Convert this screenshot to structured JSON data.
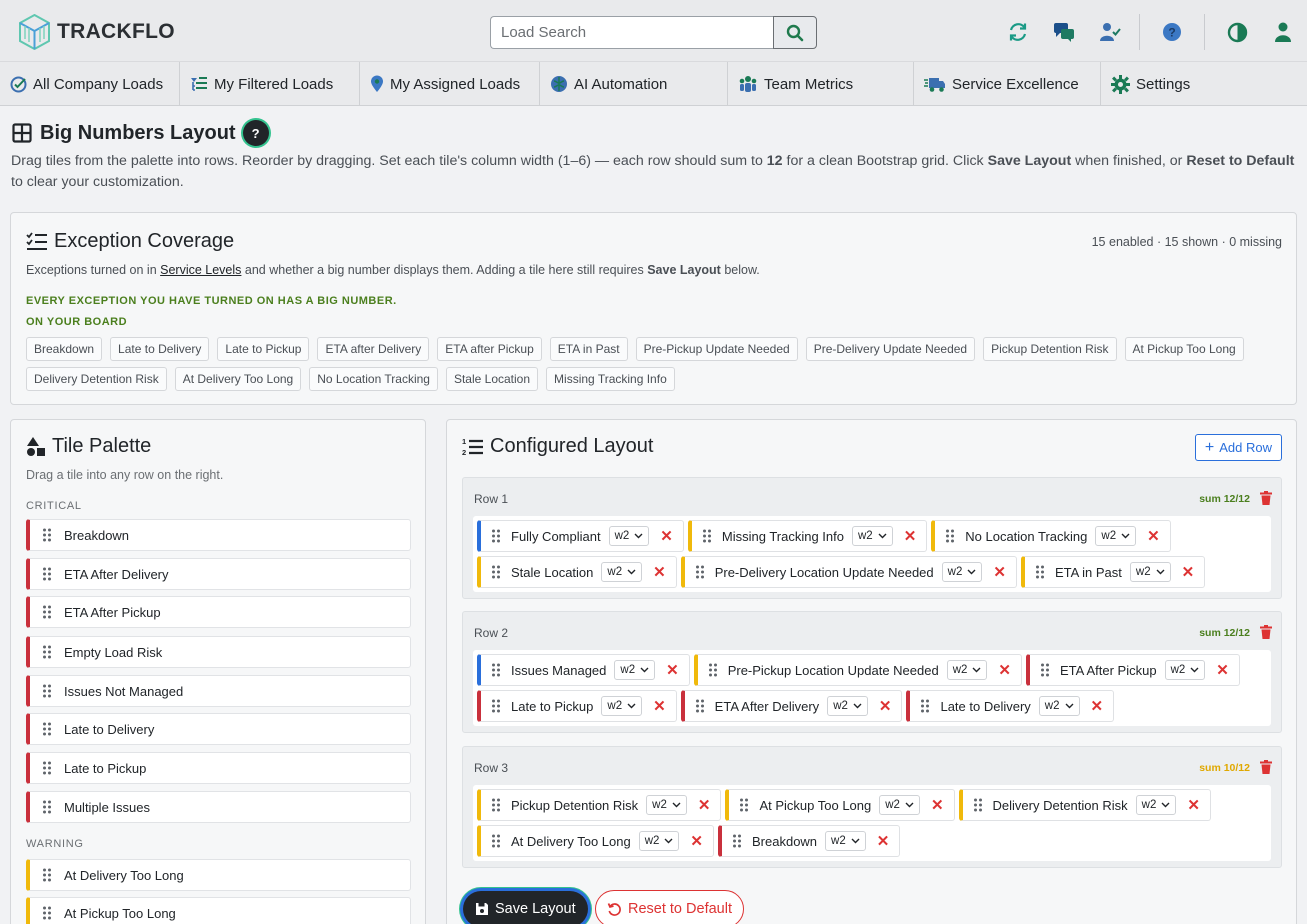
{
  "app": {
    "name": "TRACKFLO"
  },
  "search": {
    "placeholder": "Load Search"
  },
  "top_icons": [
    "refresh-icon",
    "chat-icon",
    "user-check-icon",
    "help-icon",
    "contrast-icon",
    "user-icon"
  ],
  "nav": [
    {
      "label": "All Company Loads",
      "icon": "truck-check-icon"
    },
    {
      "label": "My Filtered Loads",
      "icon": "filter-list-icon"
    },
    {
      "label": "My Assigned Loads",
      "icon": "map-pin-icon"
    },
    {
      "label": "AI Automation",
      "icon": "brain-icon"
    },
    {
      "label": "Team Metrics",
      "icon": "team-icon"
    },
    {
      "label": "Service Excellence",
      "icon": "truck-fast-icon"
    },
    {
      "label": "Settings",
      "icon": "gear-icon"
    }
  ],
  "page": {
    "title": "Big Numbers Layout",
    "help": "?",
    "intro_1": "Drag tiles from the palette into rows. Reorder by dragging. Set each tile's column width (1–6) — each row should sum to ",
    "intro_12": "12",
    "intro_2": " for a clean Bootstrap grid. Click ",
    "intro_save": "Save Layout",
    "intro_3": " when finished, or ",
    "intro_reset": "Reset to Default",
    "intro_4": " to clear your customization."
  },
  "coverage": {
    "title": "Exception Coverage",
    "stats": "15 enabled · 15 shown · 0 missing",
    "desc_1": "Exceptions turned on in ",
    "desc_link": "Service Levels",
    "desc_2": " and whether a big number displays them. Adding a tile here still requires ",
    "desc_bold": "Save Layout",
    "desc_3": " below.",
    "ok_message": "EVERY EXCEPTION YOU HAVE TURNED ON HAS A BIG NUMBER.",
    "on_board_label": "ON YOUR BOARD",
    "chips": [
      "Breakdown",
      "Late to Delivery",
      "Late to Pickup",
      "ETA after Delivery",
      "ETA after Pickup",
      "ETA in Past",
      "Pre-Pickup Update Needed",
      "Pre-Delivery Update Needed",
      "Pickup Detention Risk",
      "At Pickup Too Long",
      "Delivery Detention Risk",
      "At Delivery Too Long",
      "No Location Tracking",
      "Stale Location",
      "Missing Tracking Info"
    ]
  },
  "palette": {
    "title": "Tile Palette",
    "desc": "Drag a tile into any row on the right.",
    "critical_label": "CRITICAL",
    "critical": [
      "Breakdown",
      "ETA After Delivery",
      "ETA After Pickup",
      "Empty Load Risk",
      "Issues Not Managed",
      "Late to Delivery",
      "Late to Pickup",
      "Multiple Issues"
    ],
    "warning_label": "WARNING",
    "warning": [
      "At Delivery Too Long",
      "At Pickup Too Long"
    ]
  },
  "config": {
    "title": "Configured Layout",
    "add_row": "Add Row",
    "rows": [
      {
        "label": "Row 1",
        "sum": "sum 12/12",
        "tiles": [
          {
            "name": "Fully Compliant",
            "w": "w2",
            "level": "info"
          },
          {
            "name": "Missing Tracking Info",
            "w": "w2",
            "level": "warn"
          },
          {
            "name": "No Location Tracking",
            "w": "w2",
            "level": "warn"
          },
          {
            "name": "Stale Location",
            "w": "w2",
            "level": "warn"
          },
          {
            "name": "Pre-Delivery Location Update Needed",
            "w": "w2",
            "level": "warn"
          },
          {
            "name": "ETA in Past",
            "w": "w2",
            "level": "warn"
          }
        ]
      },
      {
        "label": "Row 2",
        "sum": "sum 12/12",
        "tiles": [
          {
            "name": "Issues Managed",
            "w": "w2",
            "level": "info"
          },
          {
            "name": "Pre-Pickup Location Update Needed",
            "w": "w2",
            "level": "warn"
          },
          {
            "name": "ETA After Pickup",
            "w": "w2",
            "level": "critical"
          },
          {
            "name": "Late to Pickup",
            "w": "w2",
            "level": "critical"
          },
          {
            "name": "ETA After Delivery",
            "w": "w2",
            "level": "critical"
          },
          {
            "name": "Late to Delivery",
            "w": "w2",
            "level": "critical"
          }
        ]
      },
      {
        "label": "Row 3",
        "sum": "sum 10/12",
        "tiles": [
          {
            "name": "Pickup Detention Risk",
            "w": "w2",
            "level": "warn"
          },
          {
            "name": "At Pickup Too Long",
            "w": "w2",
            "level": "warn"
          },
          {
            "name": "Delivery Detention Risk",
            "w": "w2",
            "level": "warn"
          },
          {
            "name": "At Delivery Too Long",
            "w": "w2",
            "level": "warn"
          },
          {
            "name": "Breakdown",
            "w": "w2",
            "level": "critical"
          }
        ]
      }
    ],
    "save": "Save Layout",
    "reset": "Reset to Default"
  },
  "colors": {
    "critical": "#c9303c",
    "warning": "#f0b90b",
    "info": "#2a6fdb",
    "ok": "#4b7f1e"
  }
}
